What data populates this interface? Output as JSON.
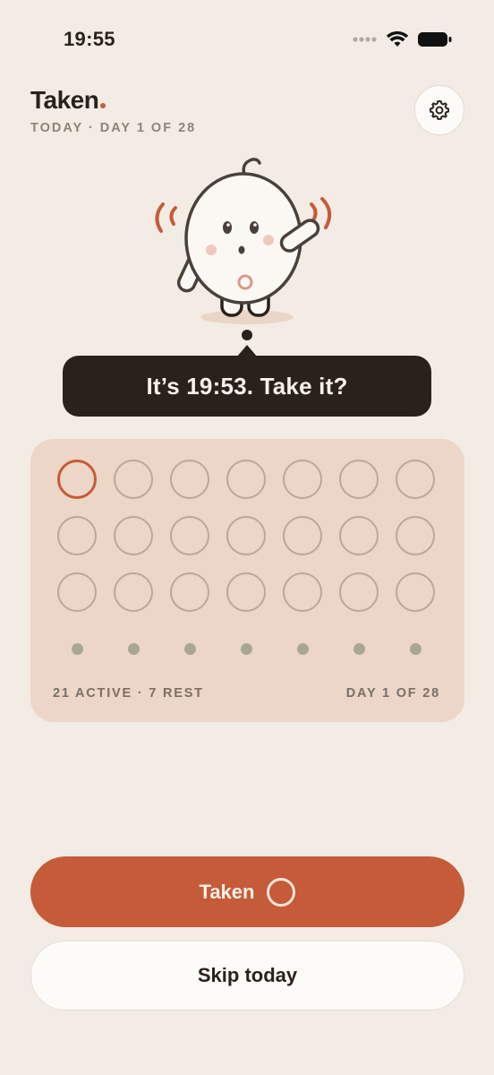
{
  "status_bar": {
    "time": "19:55",
    "icons": [
      "signal-icon",
      "wifi-icon",
      "battery-icon"
    ]
  },
  "header": {
    "app_name": "Taken",
    "subtitle": "TODAY · DAY 1 OF 28",
    "settings_icon": "gear-icon"
  },
  "prompt": {
    "text": "It’s 19:53. Take it?"
  },
  "pack": {
    "active_pills": 21,
    "rest_days": 7,
    "current_day": 1,
    "footer_left": "21 ACTIVE · 7 REST",
    "footer_right": "DAY 1 OF 28"
  },
  "actions": {
    "taken_label": "Taken",
    "skip_label": "Skip today"
  },
  "colors": {
    "background": "#F3ECE4",
    "accent": "#C65B39",
    "dark": "#2A211D",
    "card": "#ECD6C7",
    "rest_dot": "#A7A894"
  }
}
